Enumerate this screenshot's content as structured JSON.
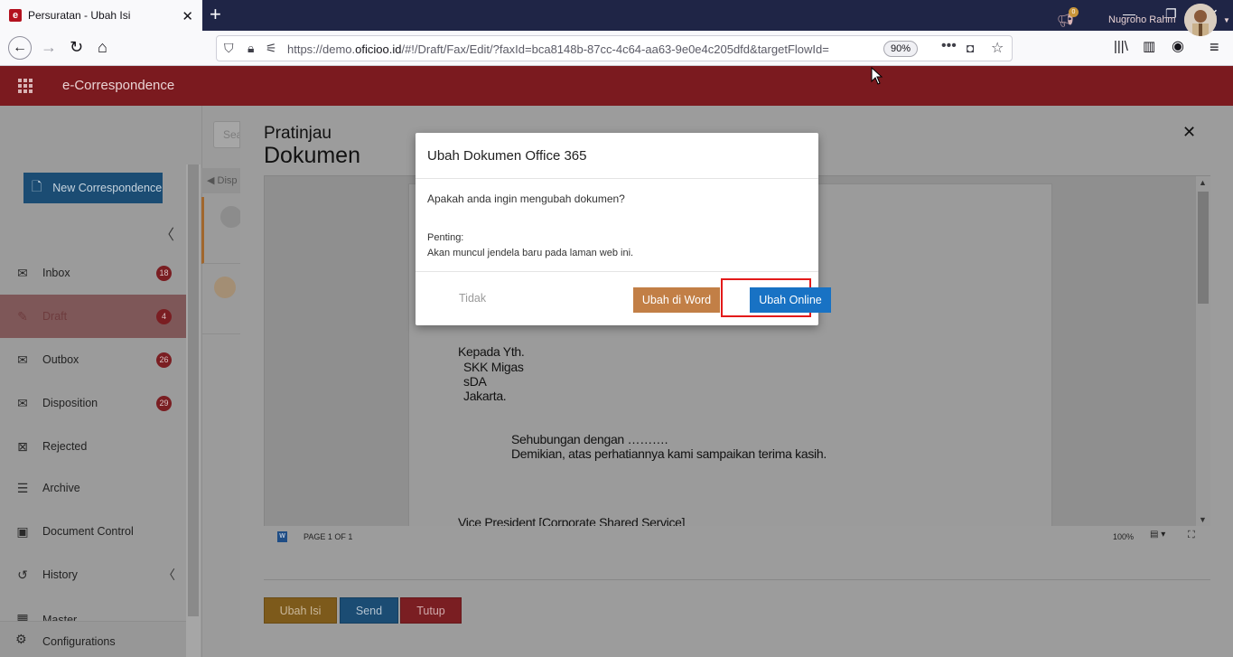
{
  "browser": {
    "tab_title": "Persuratan - Ubah Isi",
    "tab_favicon_letter": "e",
    "url_prefix": "https://demo.",
    "url_domain": "oficioo.id",
    "url_rest": "/#!/Draft/Fax/Edit/?faxId=bca8148b-87cc-4c64-aa63-9e0e4c205dfd&targetFlowId=",
    "zoom": "90%"
  },
  "app": {
    "title": "e-Correspondence",
    "notification_count": "0",
    "user_name": "Nugroho Rahm"
  },
  "sidebar": {
    "new_button": "New Correspondence",
    "items": [
      {
        "label": "Inbox",
        "count": "18"
      },
      {
        "label": "Draft",
        "count": "4"
      },
      {
        "label": "Outbox",
        "count": "26"
      },
      {
        "label": "Disposition",
        "count": "29"
      },
      {
        "label": "Rejected"
      },
      {
        "label": "Archive"
      },
      {
        "label": "Document Control"
      },
      {
        "label": "History"
      },
      {
        "label": "Master"
      }
    ],
    "config_label": "Configurations"
  },
  "middle": {
    "search_placeholder": "Sea",
    "tab_label": "Disp"
  },
  "preview": {
    "title_small": "Pratinjau",
    "title_large": "Dokumen",
    "doc_lines": [
      "Kepada Yth.",
      "SKK Migas",
      "sDA",
      "Jakarta.",
      "Sehubungan dengan ……….",
      "Demikian, atas perhatiannya kami sampaikan terima kasih.",
      "Vice President [Corporate Shared Service]"
    ],
    "page_indicator": "PAGE 1 OF 1",
    "zoom_indicator": "100%",
    "buttons": {
      "edit": "Ubah Isi",
      "send": "Send",
      "close": "Tutup"
    }
  },
  "modal": {
    "title": "Ubah Dokumen Office 365",
    "question": "Apakah anda ingin mengubah dokumen?",
    "note_heading": "Penting:",
    "note_text": "Akan muncul jendela baru pada laman web ini.",
    "btn_no": "Tidak",
    "btn_word": "Ubah di Word",
    "btn_online": "Ubah Online"
  },
  "colors": {
    "header": "#7b1a1f",
    "primary": "#1872c4",
    "word_button": "#c27f46",
    "highlight": "#e31a1a"
  }
}
